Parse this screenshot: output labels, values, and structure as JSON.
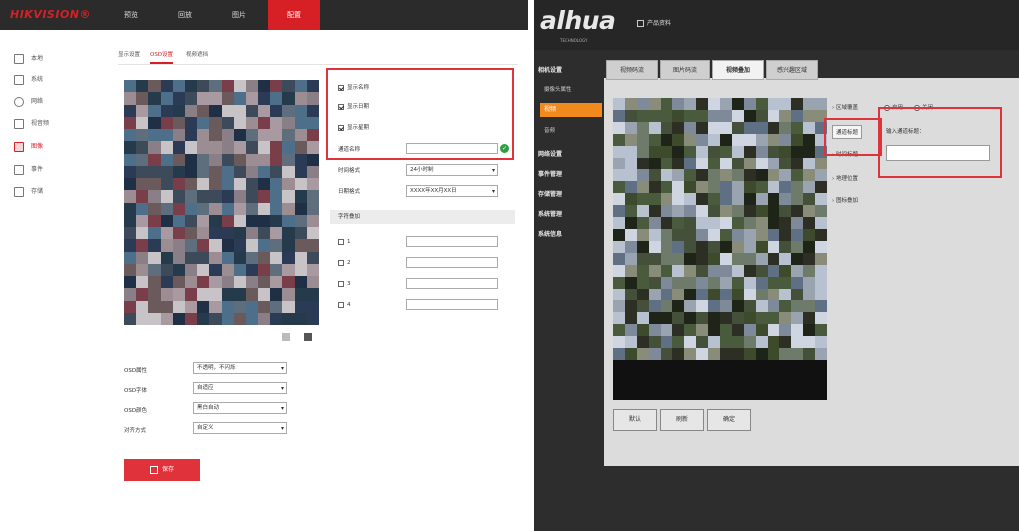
{
  "hik": {
    "logo": "HIKVISION®",
    "nav": [
      {
        "label": "预览",
        "active": false
      },
      {
        "label": "回放",
        "active": false
      },
      {
        "label": "图片",
        "active": false
      },
      {
        "label": "配置",
        "active": true
      }
    ],
    "sidebar": [
      {
        "label": "本地",
        "icon": "monitor-icon",
        "active": false
      },
      {
        "label": "系统",
        "icon": "system-icon",
        "active": false
      },
      {
        "label": "网络",
        "icon": "network-icon",
        "active": false
      },
      {
        "label": "视音频",
        "icon": "video-audio-icon",
        "active": false
      },
      {
        "label": "图像",
        "icon": "image-icon",
        "active": true
      },
      {
        "label": "事件",
        "icon": "event-icon",
        "active": false
      },
      {
        "label": "存储",
        "icon": "storage-icon",
        "active": false
      }
    ],
    "tabs": [
      {
        "label": "显示设置",
        "active": false
      },
      {
        "label": "OSD设置",
        "active": true
      },
      {
        "label": "视频遮挡",
        "active": false
      }
    ],
    "checkboxes": [
      {
        "label": "显示名称",
        "checked": true
      },
      {
        "label": "显示日期",
        "checked": true
      },
      {
        "label": "显示星期",
        "checked": true
      }
    ],
    "channel_name_label": "通道名称",
    "channel_name_value": "",
    "time_format_label": "时间格式",
    "time_format_value": "24小时制",
    "date_format_label": "日期格式",
    "date_format_value": "XXXX年XX月XX日",
    "overlay_section": "字符叠加",
    "overlay_rows": [
      {
        "label": "1",
        "checked": false,
        "value": ""
      },
      {
        "label": "2",
        "checked": false,
        "value": ""
      },
      {
        "label": "3",
        "checked": false,
        "value": ""
      },
      {
        "label": "4",
        "checked": false,
        "value": ""
      }
    ],
    "osd_attr_label": "OSD属性",
    "osd_attr_value": "不透明，不闪烁",
    "osd_font_label": "OSD字体",
    "osd_font_value": "自适应",
    "osd_color_label": "OSD颜色",
    "osd_color_value": "黑白自动",
    "align_label": "对齐方式",
    "align_value": "自定义",
    "save_label": "保存",
    "accent": "#d71f26"
  },
  "dahua": {
    "logo": "alhua",
    "logo_sub": "TECHNOLOGY",
    "top_menu": "产品资料",
    "sidebar": [
      {
        "label": "相机设置",
        "kind": "group"
      },
      {
        "label": "摄像头属性",
        "kind": "sub"
      },
      {
        "label": "视频",
        "kind": "active"
      },
      {
        "label": "音频",
        "kind": "sub"
      },
      {
        "label": "网络设置",
        "kind": "group"
      },
      {
        "label": "事件管理",
        "kind": "group"
      },
      {
        "label": "存储管理",
        "kind": "group"
      },
      {
        "label": "系统管理",
        "kind": "group"
      },
      {
        "label": "系统信息",
        "kind": "group"
      }
    ],
    "tabs": [
      {
        "label": "视频码流",
        "active": false
      },
      {
        "label": "图片码流",
        "active": false
      },
      {
        "label": "视频叠加",
        "active": true
      },
      {
        "label": "感兴趣区域",
        "active": false
      }
    ],
    "overlay_options": [
      {
        "label": "区域覆盖",
        "active": false
      },
      {
        "label": "通道标题",
        "active": true
      },
      {
        "label": "时间标题",
        "active": false
      },
      {
        "label": "地理位置",
        "active": false
      },
      {
        "label": "图标叠加",
        "active": false
      }
    ],
    "radio_options": [
      {
        "label": "启用",
        "on": true
      },
      {
        "label": "关闭",
        "on": false
      }
    ],
    "input_label": "输入通道标题：",
    "input_value": "",
    "buttons": [
      "默认",
      "刷新",
      "确定"
    ],
    "accent": "#f08a1c"
  }
}
